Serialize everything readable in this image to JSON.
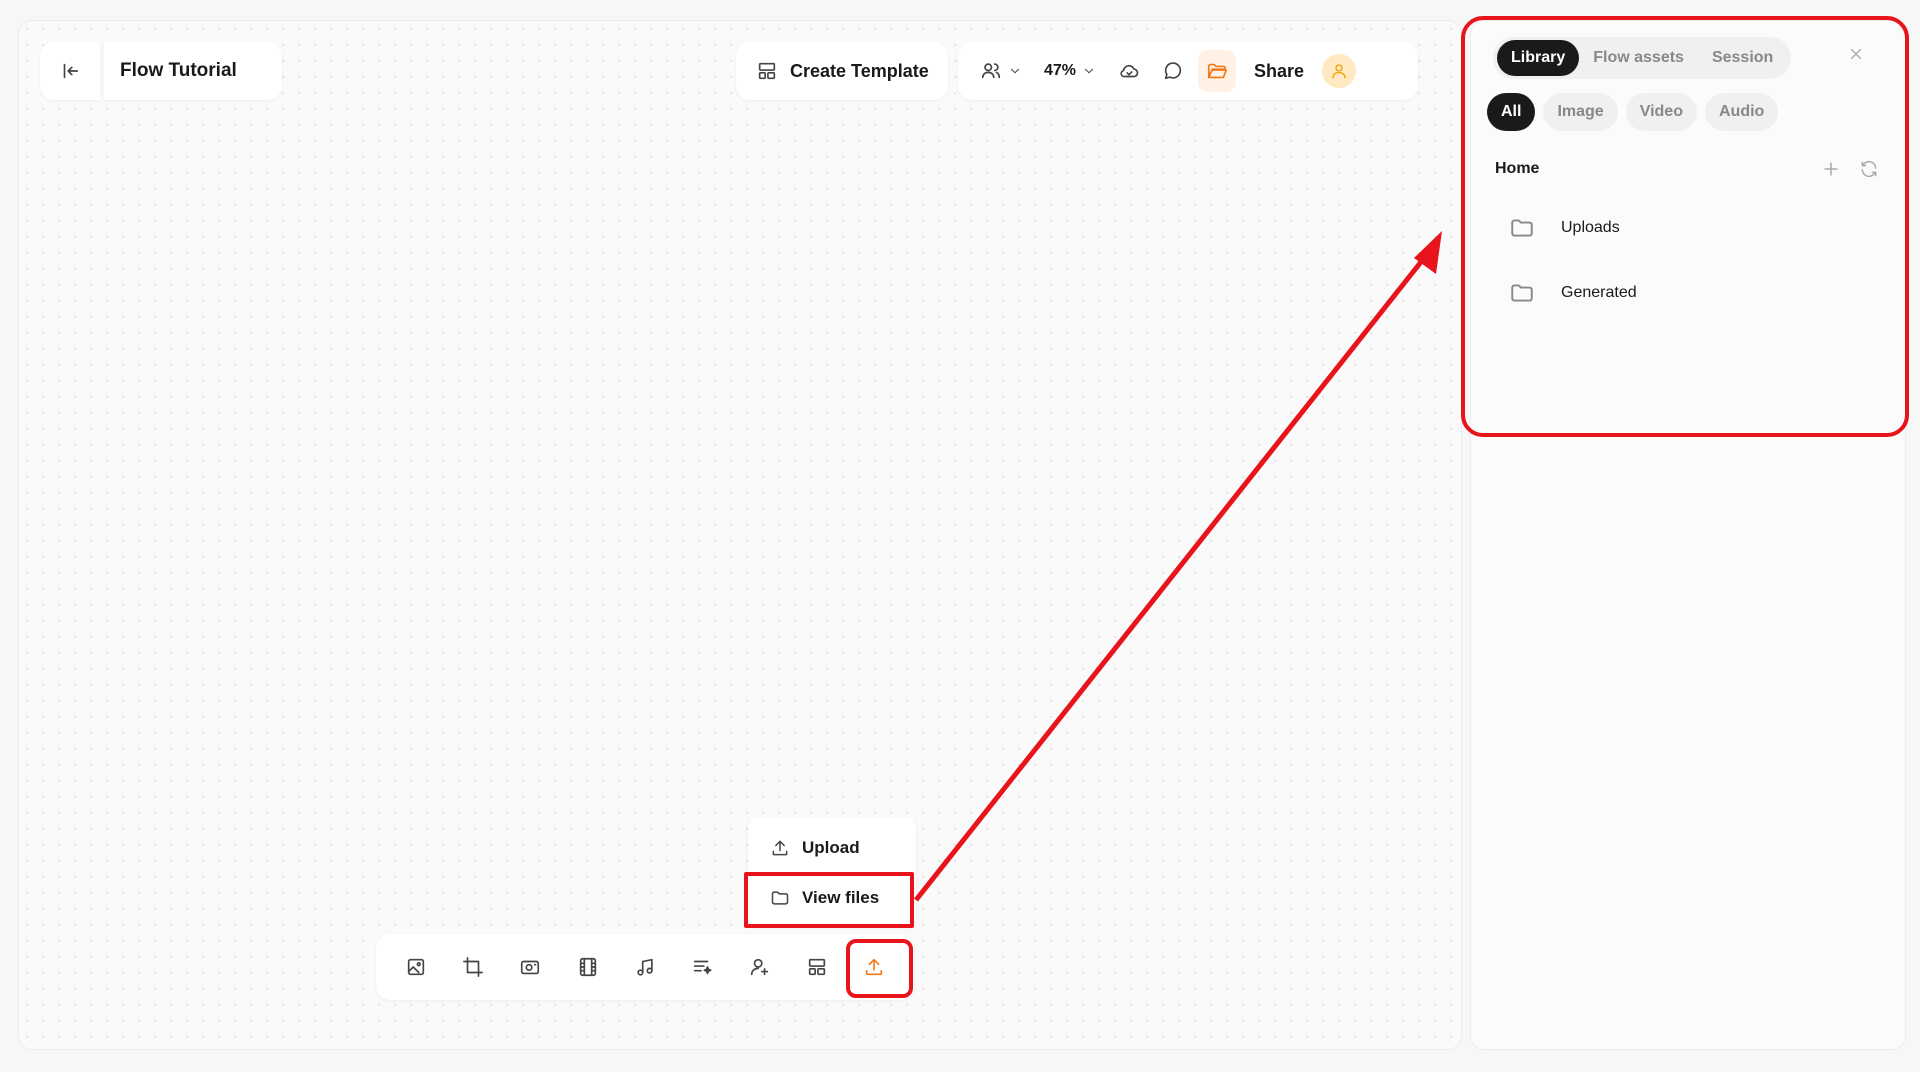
{
  "header": {
    "title": "Flow Tutorial",
    "create_template_label": "Create Template",
    "zoom": "47%",
    "share_label": "Share"
  },
  "upload_menu": {
    "items": [
      {
        "label": "Upload",
        "icon": "upload-icon"
      },
      {
        "label": "View files",
        "icon": "folder-icon"
      }
    ]
  },
  "bottom_toolbar": {
    "tools": [
      "image-icon",
      "crop-icon",
      "camera-icon",
      "film-icon",
      "music-icon",
      "text-sparkle-icon",
      "user-add-icon",
      "layout-icon",
      "upload-icon"
    ],
    "active_tool": "upload-icon"
  },
  "panel": {
    "tabs": [
      {
        "label": "Library",
        "active": true
      },
      {
        "label": "Flow assets",
        "active": false
      },
      {
        "label": "Session",
        "active": false
      }
    ],
    "filters": [
      {
        "label": "All",
        "active": true
      },
      {
        "label": "Image",
        "active": false
      },
      {
        "label": "Video",
        "active": false
      },
      {
        "label": "Audio",
        "active": false
      }
    ],
    "breadcrumb": "Home",
    "folders": [
      {
        "name": "Uploads"
      },
      {
        "name": "Generated"
      }
    ]
  },
  "colors": {
    "accent": "#f07a1a",
    "annotation": "#e8141b",
    "active_tab": "#1a1a1a"
  }
}
